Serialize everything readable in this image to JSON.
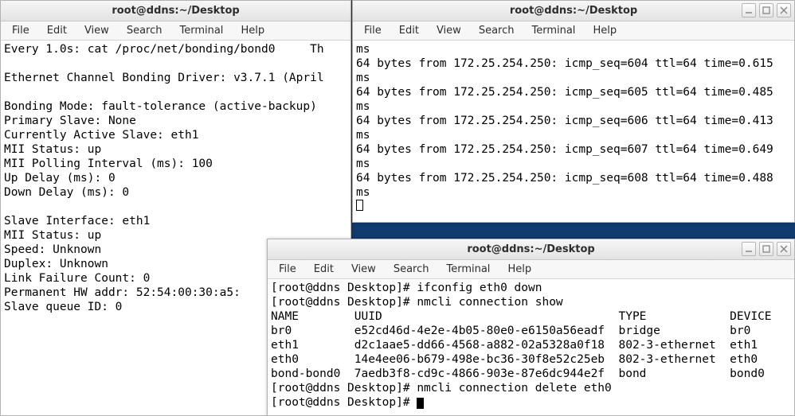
{
  "title": "root@ddns:~/Desktop",
  "menus": [
    "File",
    "Edit",
    "View",
    "Search",
    "Terminal",
    "Help"
  ],
  "win1": {
    "lines": [
      "Every 1.0s: cat /proc/net/bonding/bond0     Th",
      "",
      "Ethernet Channel Bonding Driver: v3.7.1 (April",
      "",
      "Bonding Mode: fault-tolerance (active-backup)",
      "Primary Slave: None",
      "Currently Active Slave: eth1",
      "MII Status: up",
      "MII Polling Interval (ms): 100",
      "Up Delay (ms): 0",
      "Down Delay (ms): 0",
      "",
      "Slave Interface: eth1",
      "MII Status: up",
      "Speed: Unknown",
      "Duplex: Unknown",
      "Link Failure Count: 0",
      "Permanent HW addr: 52:54:00:30:a5:",
      "Slave queue ID: 0"
    ]
  },
  "win2": {
    "lines": [
      "ms",
      "64 bytes from 172.25.254.250: icmp_seq=604 ttl=64 time=0.615",
      "ms",
      "64 bytes from 172.25.254.250: icmp_seq=605 ttl=64 time=0.485",
      "ms",
      "64 bytes from 172.25.254.250: icmp_seq=606 ttl=64 time=0.413",
      "ms",
      "64 bytes from 172.25.254.250: icmp_seq=607 ttl=64 time=0.649",
      "ms",
      "64 bytes from 172.25.254.250: icmp_seq=608 ttl=64 time=0.488",
      "ms"
    ]
  },
  "win3": {
    "lines": [
      "[root@ddns Desktop]# ifconfig eth0 down",
      "[root@ddns Desktop]# nmcli connection show",
      "NAME        UUID                                  TYPE            DEVICE",
      "br0         e52cd46d-4e2e-4b05-80e0-e6150a56eadf  bridge          br0",
      "eth1        d2c1aae5-dd66-4568-a882-02a5328a0f18  802-3-ethernet  eth1",
      "eth0        14e4ee06-b679-498e-bc36-30f8e52c25eb  802-3-ethernet  eth0",
      "bond-bond0  7aedb3f8-cd9c-4866-903e-87e6dc944e2f  bond            bond0",
      "[root@ddns Desktop]# nmcli connection delete eth0",
      "[root@ddns Desktop]# "
    ]
  }
}
